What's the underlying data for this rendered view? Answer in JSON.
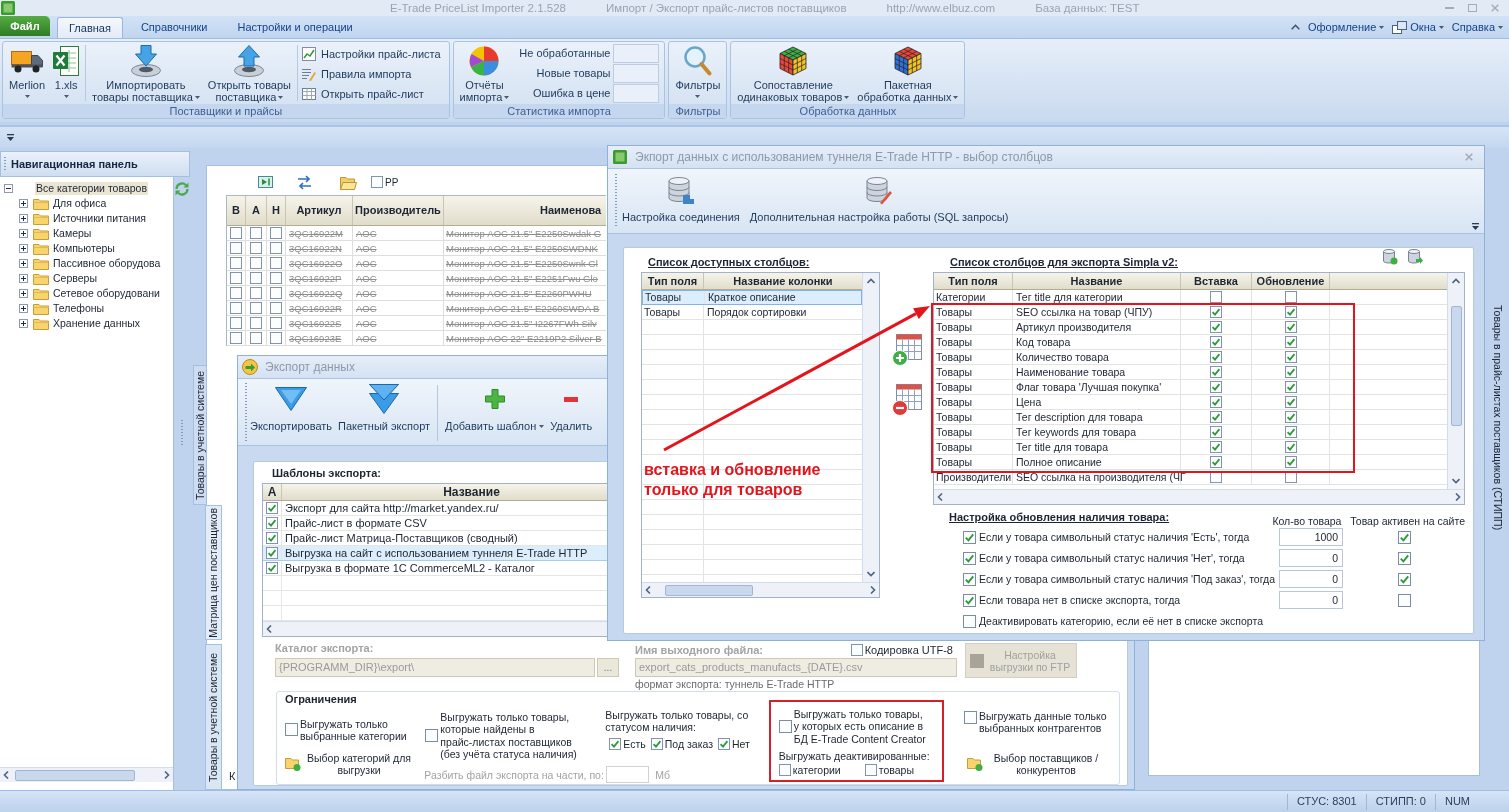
{
  "window": {
    "title_parts": [
      "E-Trade PriceList Importer 2.1.528",
      "Импорт / Экспорт прайс-листов поставщиков",
      "http://www.elbuz.com",
      "База данных: TEST"
    ]
  },
  "ribbon": {
    "file_tab": "Файл",
    "tabs": [
      {
        "label": "Главная",
        "selected": true
      },
      {
        "label": "Справочники",
        "selected": false
      },
      {
        "label": "Настройки и операции",
        "selected": false
      }
    ],
    "menus": [
      {
        "label": "Оформление",
        "dropdown": true
      },
      {
        "label": "Окна",
        "dropdown": true
      },
      {
        "label": "Справка",
        "dropdown": true
      }
    ],
    "groups": [
      {
        "title": "Поставщики и прайсы",
        "large": [
          {
            "lines": [
              "Merlion"
            ],
            "dropdown": true
          },
          {
            "lines": [
              "1.xls"
            ],
            "dropdown": true
          },
          {
            "lines": [
              "Импортировать",
              "товары поставщика"
            ],
            "dropdown": true
          },
          {
            "lines": [
              "Открыть товары",
              "поставщика"
            ],
            "dropdown": true
          }
        ],
        "small": [
          "Настройки прайс-листа",
          "Правила импорта",
          "Открыть прайс-лист"
        ]
      },
      {
        "title": "Статистика импорта",
        "large": [
          {
            "lines": [
              "Отчёты",
              "импорта"
            ],
            "dropdown": true
          }
        ],
        "stats": [
          "Не обработанные",
          "Новые товары",
          "Ошибка в цене"
        ]
      },
      {
        "title": "Фильтры",
        "large": [
          {
            "lines": [
              "Фильтры"
            ],
            "dropdown": true
          }
        ]
      },
      {
        "title": "Обработка данных",
        "large": [
          {
            "lines": [
              "Сопоставление",
              "одинаковых товаров"
            ],
            "dropdown": true
          },
          {
            "lines": [
              "Пакетная",
              "обработка данных"
            ],
            "dropdown": true
          }
        ]
      }
    ]
  },
  "navigation": {
    "title": "Навигационная панель",
    "tree": [
      {
        "label": "Все категории товаров",
        "expanded": true,
        "selected": true,
        "children": [
          {
            "label": "Для офиса",
            "expanded": false,
            "selected": false
          },
          {
            "label": "Источники питания",
            "expanded": false,
            "selected": false
          },
          {
            "label": "Камеры",
            "expanded": false,
            "selected": false
          },
          {
            "label": "Компьютеры",
            "expanded": false,
            "selected": false
          },
          {
            "label": "Пассивное оборудова",
            "expanded": false,
            "selected": false
          },
          {
            "label": "Серверы",
            "expanded": false,
            "selected": false
          },
          {
            "label": "Сетевое оборудовани",
            "expanded": false,
            "selected": false
          },
          {
            "label": "Телефоны",
            "expanded": false,
            "selected": false
          },
          {
            "label": "Хранение данных",
            "expanded": false,
            "selected": false
          }
        ]
      }
    ]
  },
  "workspace": {
    "side_tabs": [
      "Товары в учетной системе",
      "Матрица цен поставщиков",
      "Товары в учетной системе"
    ],
    "right_tab": "Товары в прайс-листах поставщиков (СТИПП)",
    "cut_label": "К",
    "products_grid": {
      "filter_checkbox": {
        "label": "PP",
        "checked": false
      },
      "columns": [
        "В",
        "А",
        "Н",
        "Артикул",
        "Производитель",
        "Наименова"
      ],
      "rows": [
        {
          "flags": [
            false,
            false,
            false
          ],
          "article": "3QC16922M",
          "maker": "AOC",
          "name": "Монитор AOC 21.5\" E2250Swdak G",
          "struck": true
        },
        {
          "flags": [
            false,
            false,
            false
          ],
          "article": "3QC16922N",
          "maker": "AOC",
          "name": "Монитор AOC 21.5\" E2250SWDNK",
          "struck": true
        },
        {
          "flags": [
            false,
            false,
            false
          ],
          "article": "3QC16922O",
          "maker": "AOC",
          "name": "Монитор AOC 21.5\" E2250Swnk Gl",
          "struck": true
        },
        {
          "flags": [
            false,
            false,
            false
          ],
          "article": "3QC16922P",
          "maker": "AOC",
          "name": "Монитор AOC 21.5\" E2251Fwu Glo",
          "struck": true
        },
        {
          "flags": [
            false,
            false,
            false
          ],
          "article": "3QC16922Q",
          "maker": "AOC",
          "name": "Монитор AOC 21.5\" E2260PWHU",
          "struck": true
        },
        {
          "flags": [
            false,
            false,
            false
          ],
          "article": "3QC16922R",
          "maker": "AOC",
          "name": "Монитор AOC 21.5\" E2260SWDA B",
          "struck": true
        },
        {
          "flags": [
            false,
            false,
            false
          ],
          "article": "3QC16922S",
          "maker": "AOC",
          "name": "Монитор AOC 21.5\" I2267FWh Silv",
          "struck": true
        },
        {
          "flags": [
            false,
            false,
            false
          ],
          "article": "3QC16923E",
          "maker": "AOC",
          "name": "Монитор AOC 22\" E2219P2 Silver B",
          "struck": true
        }
      ]
    }
  },
  "export_dialog": {
    "title": "Экспорт данных",
    "toolbar": [
      {
        "label": "Экспортировать",
        "dropdown": false
      },
      {
        "label": "Пакетный экспорт",
        "dropdown": false
      },
      {
        "label": "Добавить шаблон",
        "dropdown": true
      },
      {
        "label": "Удалить",
        "dropdown": false
      }
    ],
    "templates": {
      "label": "Шаблоны экспорта:",
      "columns": [
        "А",
        "Название"
      ],
      "rows": [
        {
          "active": true,
          "selected": false,
          "name": "Экспорт для сайта http://market.yandex.ru/"
        },
        {
          "active": true,
          "selected": false,
          "name": "Прайс-лист в формате CSV"
        },
        {
          "active": true,
          "selected": false,
          "name": "Прайс-лист Матрица-Поставщиков (сводный)"
        },
        {
          "active": true,
          "selected": true,
          "name": "Выгрузка на сайт с использованием туннеля E-Trade HTTP"
        },
        {
          "active": true,
          "selected": false,
          "name": "Выгрузка в формате 1C CommerceML2 - Каталог"
        }
      ]
    },
    "catalog": {
      "label": "Каталог экспорта:",
      "value": "{PROGRAMM_DIR}\\export\\",
      "browse": "...",
      "disabled": true
    },
    "output_file": {
      "label": "Имя выходного файла:",
      "value": "export_cats_products_manufacts_{DATE}.csv",
      "note": "формат экспорта: туннель E-Trade HTTP",
      "disabled": true
    },
    "utf8": {
      "label": "Кодировка UTF-8",
      "checked": false
    },
    "ftp_button": {
      "label": "Настройка выгрузки по FTP",
      "disabled": true
    },
    "restrictions": {
      "title": "Ограничения",
      "only_selected_categories": {
        "label": "Выгружать только выбранные категории",
        "checked": false
      },
      "choose_categories": "Выбор категорий для выгрузки",
      "only_found": {
        "label": "Выгружать только товары,\nкоторые найдены в\nпрайс-листах поставщиков\n(без учёта статуса наличия)",
        "checked": false
      },
      "split": {
        "label": "Разбить файл экспорта на части, по:",
        "unit": "Мб",
        "disabled": true
      },
      "status_filter": {
        "label": "Выгружать только товары, со статусом наличия:",
        "options": [
          {
            "label": "Есть",
            "checked": true
          },
          {
            "label": "Под заказ",
            "checked": true
          },
          {
            "label": "Нет",
            "checked": true
          }
        ]
      },
      "only_described": {
        "label": "Выгружать только товары, у которых есть описание в БД E-Trade Content Creator",
        "checked": false
      },
      "deactivated": {
        "label": "Выгружать деактивированные:",
        "options": [
          {
            "label": "категории",
            "checked": false
          },
          {
            "label": "товары",
            "checked": false
          }
        ]
      },
      "only_selected_contractors": {
        "label": "Выгружать данные только выбранных контрагентов",
        "checked": false
      },
      "choose_suppliers": "Выбор поставщиков / конкурентов"
    }
  },
  "columns_dialog": {
    "title": "Экпорт данных с использованием туннеля E-Trade HTTP - выбор столбцов",
    "toolbar": [
      {
        "label": "Настройка соединения"
      },
      {
        "label": "Дополнительная настройка работы (SQL запросы)"
      }
    ],
    "available": {
      "label": "Список доступных столбцов:",
      "columns": [
        "Тип поля",
        "Название колонки"
      ],
      "rows": [
        {
          "type": "Товары",
          "name": "Краткое описание",
          "selected": true
        },
        {
          "type": "Товары",
          "name": "Порядок сортировки",
          "selected": false
        }
      ]
    },
    "export_columns": {
      "label": "Список столбцов для экспорта Simpla v2:",
      "columns": [
        "Тип поля",
        "Название",
        "Вставка",
        "Обновление"
      ],
      "rows": [
        {
          "type": "Категории",
          "name": "Тег title для категории",
          "insert": false,
          "update": false
        },
        {
          "type": "Товары",
          "name": "SEO ссылка на товар (ЧПУ)",
          "insert": true,
          "update": true
        },
        {
          "type": "Товары",
          "name": "Артикул производителя",
          "insert": true,
          "update": true
        },
        {
          "type": "Товары",
          "name": "Код товара",
          "insert": true,
          "update": true
        },
        {
          "type": "Товары",
          "name": "Количество товара",
          "insert": true,
          "update": true
        },
        {
          "type": "Товары",
          "name": "Наименование товара",
          "insert": true,
          "update": true
        },
        {
          "type": "Товары",
          "name": "Флаг товара 'Лучшая покупка'",
          "insert": true,
          "update": true
        },
        {
          "type": "Товары",
          "name": "Цена",
          "insert": true,
          "update": true
        },
        {
          "type": "Товары",
          "name": "Тег description для товара",
          "insert": true,
          "update": true
        },
        {
          "type": "Товары",
          "name": "Тег keywords для товара",
          "insert": true,
          "update": true
        },
        {
          "type": "Товары",
          "name": "Тег title для товара",
          "insert": true,
          "update": true
        },
        {
          "type": "Товары",
          "name": "Полное описание",
          "insert": true,
          "update": true
        },
        {
          "type": "Производители",
          "name": "SEO ссылка на производителя (ЧГ",
          "insert": false,
          "update": false
        }
      ]
    },
    "stock_settings": {
      "label": "Настройка обновления наличия товара:",
      "columns": [
        "Кол-во товара",
        "Товар активен на сайте"
      ],
      "rows": [
        {
          "label": "Если у товара символьный статус наличия 'Есть', тогда",
          "checked": true,
          "quantity": "1000",
          "active": true
        },
        {
          "label": "Если у товара символьный статус наличия 'Нет', тогда",
          "checked": true,
          "quantity": "0",
          "active": true
        },
        {
          "label": "Если у товара символьный статус наличия 'Под заказ', тогда",
          "checked": true,
          "quantity": "0",
          "active": true
        },
        {
          "label": "Если товара нет в списке экспорта, тогда",
          "checked": true,
          "quantity": "0",
          "active": false
        },
        {
          "label": "Деактивировать категорию, если её нет в списке экспорта",
          "checked": false
        }
      ]
    },
    "annotation": {
      "text": "вставка и обновление только для товаров"
    }
  },
  "status_bar": [
    "СТУС: 8301",
    "СТИПП: 0",
    "NUM"
  ]
}
